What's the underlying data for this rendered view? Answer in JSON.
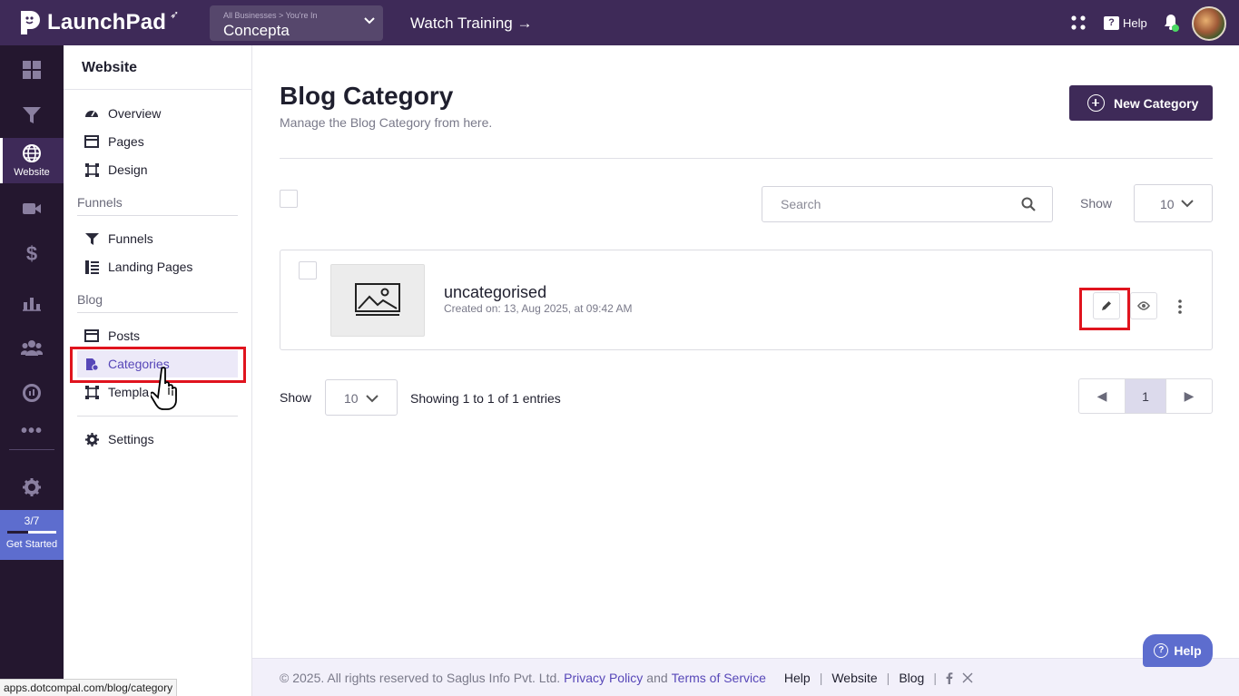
{
  "topbar": {
    "app_name": "LaunchPad",
    "business_sub": "All Businesses > You're In",
    "business_name": "Concepta",
    "watch_training": "Watch Training →",
    "help_label": "Help"
  },
  "rail": {
    "items": [
      {
        "icon": "dashboard-icon",
        "label": ""
      },
      {
        "icon": "funnel-icon",
        "label": ""
      },
      {
        "icon": "globe-icon",
        "label": "Website",
        "active": true
      },
      {
        "icon": "video-icon",
        "label": ""
      },
      {
        "icon": "dollar-icon",
        "label": ""
      },
      {
        "icon": "analytics-icon",
        "label": ""
      },
      {
        "icon": "users-icon",
        "label": ""
      },
      {
        "icon": "reports-icon",
        "label": ""
      },
      {
        "icon": "more-icon",
        "label": ""
      },
      {
        "icon": "settings-icon",
        "label": ""
      }
    ],
    "get_started": {
      "count": "3/7",
      "label": "Get Started",
      "progress": 0.43
    }
  },
  "sidebar": {
    "title": "Website",
    "items": [
      {
        "label": "Overview",
        "icon": "gauge-icon"
      },
      {
        "label": "Pages",
        "icon": "pages-icon"
      },
      {
        "label": "Design",
        "icon": "design-icon"
      }
    ],
    "funnels_section": "Funnels",
    "funnels_items": [
      {
        "label": "Funnels",
        "icon": "funnel-icon"
      },
      {
        "label": "Landing Pages",
        "icon": "landing-pages-icon"
      }
    ],
    "blog_section": "Blog",
    "blog_items": [
      {
        "label": "Posts",
        "icon": "posts-icon"
      },
      {
        "label": "Categories",
        "icon": "categories-icon",
        "active": true
      },
      {
        "label": "Templa",
        "icon": "templates-icon"
      }
    ],
    "settings_label": "Settings"
  },
  "main": {
    "title": "Blog Category",
    "subtitle": "Manage the Blog Category from here.",
    "new_button": "New Category",
    "search_placeholder": "Search",
    "show_label": "Show",
    "page_size": "10",
    "categories": [
      {
        "name": "uncategorised",
        "created": "Created on: 13, Aug 2025, at 09:42 AM"
      }
    ],
    "entries_text": "Showing 1 to 1 of 1 entries",
    "pagination": {
      "prev": "◀",
      "current": "1",
      "next": "▶"
    }
  },
  "footer": {
    "copyright": "©  2025. All rights reserved to Saglus Info Pvt. Ltd.",
    "privacy": "Privacy Policy",
    "and": "and",
    "terms": "Terms of Service",
    "links": [
      "Help",
      "Website",
      "Blog"
    ],
    "social": [
      "facebook-icon",
      "x-icon"
    ]
  },
  "help_float": "Help",
  "status_url": "apps.dotcompal.com/blog/category",
  "colors": {
    "primary": "#3e2a58",
    "accent": "#5747b8",
    "highlight": "#e0141e",
    "rail": "#24172f"
  }
}
